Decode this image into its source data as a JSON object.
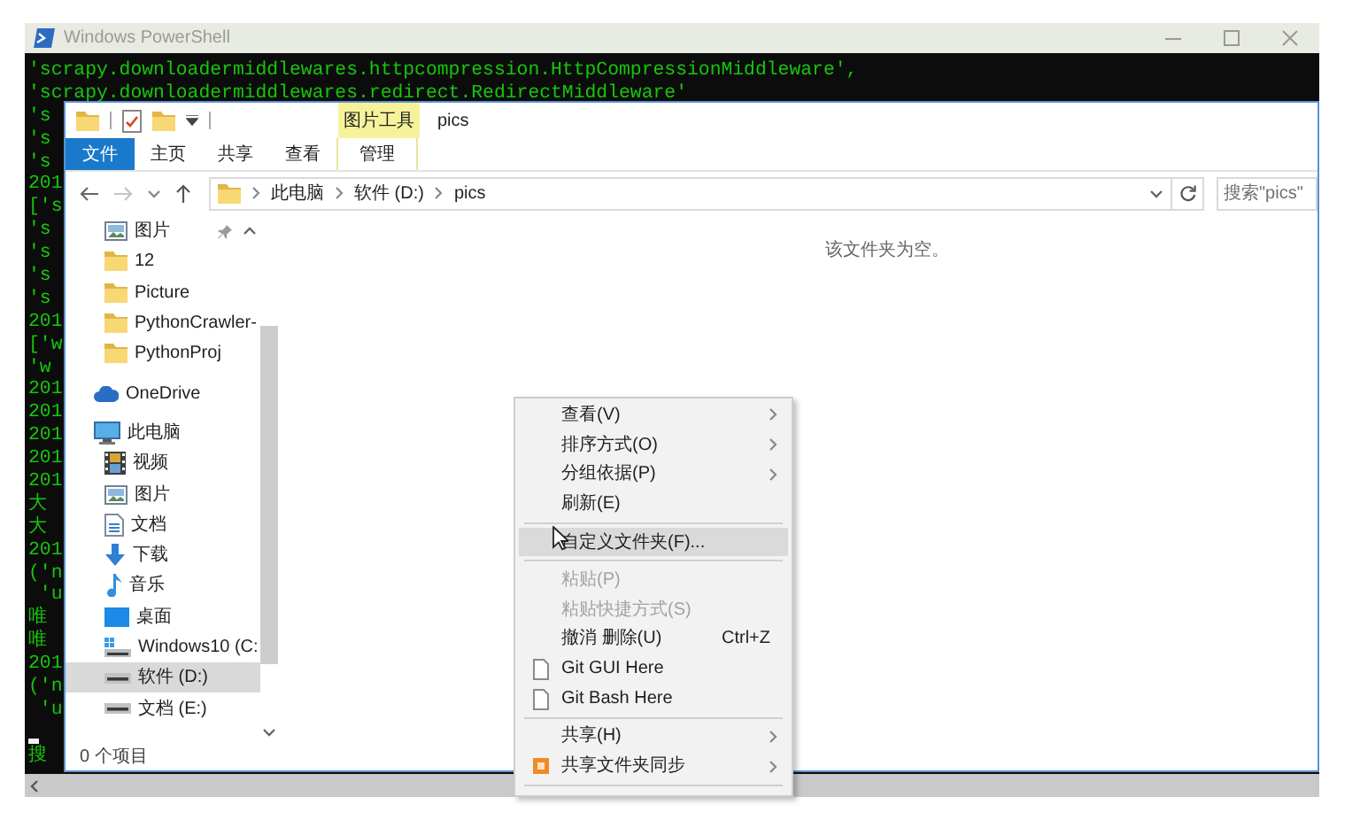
{
  "console": {
    "title": "Windows PowerShell",
    "lines": [
      {
        "kind": "output",
        "text": "'scrapy.downloadermiddlewares.httpcompression.HttpCompressionMiddleware',"
      },
      {
        "kind": "output",
        "text": "'scrapy.downloadermiddlewares.redirect.RedirectMiddleware'"
      },
      {
        "kind": "output",
        "text": "'s"
      },
      {
        "kind": "output",
        "text": "'s"
      },
      {
        "kind": "output",
        "text": "'s"
      },
      {
        "kind": "output",
        "text": "201"
      },
      {
        "kind": "output",
        "text": "['s"
      },
      {
        "kind": "output",
        "text": "'s"
      },
      {
        "kind": "output",
        "text": "'s"
      },
      {
        "kind": "output",
        "text": "'s"
      },
      {
        "kind": "output",
        "text": "'s"
      },
      {
        "kind": "output",
        "text": "201"
      },
      {
        "kind": "output",
        "text": "['w"
      },
      {
        "kind": "output",
        "text": "'w"
      },
      {
        "kind": "output",
        "text": "201"
      },
      {
        "kind": "output",
        "text": "201"
      },
      {
        "kind": "output",
        "text": "201"
      },
      {
        "kind": "output",
        "text": "201"
      },
      {
        "kind": "output",
        "text": "201"
      },
      {
        "kind": "output",
        "text": "大"
      },
      {
        "kind": "output",
        "text": "大"
      },
      {
        "kind": "output",
        "text": "201"
      },
      {
        "kind": "output",
        "text": "('n"
      },
      {
        "kind": "output",
        "text": " 'u"
      },
      {
        "kind": "output",
        "text": "唯"
      },
      {
        "kind": "output",
        "text": "唯"
      },
      {
        "kind": "output",
        "text": "201"
      },
      {
        "kind": "output",
        "text": "('n"
      },
      {
        "kind": "output",
        "text": " 'u"
      },
      {
        "kind": "cursor"
      },
      {
        "kind": "output",
        "text": "搜"
      }
    ]
  },
  "explorer": {
    "context_tab": "图片工具",
    "title": "pics",
    "ribbon_tabs": [
      {
        "label": "文件",
        "kind": "file"
      },
      {
        "label": "主页",
        "kind": "normal"
      },
      {
        "label": "共享",
        "kind": "normal"
      },
      {
        "label": "查看",
        "kind": "normal"
      },
      {
        "label": "管理",
        "kind": "context"
      }
    ],
    "breadcrumb": [
      "此电脑",
      "软件 (D:)",
      "pics"
    ],
    "search": {
      "placeholder": "搜索\"pics\""
    },
    "nav": {
      "quick_access": {
        "expanded": true,
        "items": [
          {
            "label": "图片",
            "kind": "pictures",
            "pinned": true,
            "selected": false
          },
          {
            "label": "12",
            "kind": "folder",
            "pinned": false,
            "selected": false
          },
          {
            "label": "Picture",
            "kind": "folder",
            "pinned": false,
            "selected": false
          },
          {
            "label": "PythonCrawler-",
            "kind": "folder",
            "pinned": false,
            "selected": false
          },
          {
            "label": "PythonProj",
            "kind": "folder",
            "pinned": false,
            "selected": false
          }
        ]
      },
      "roots": [
        {
          "label": "OneDrive",
          "kind": "cloud",
          "selected": false
        },
        {
          "label": "此电脑",
          "kind": "computer",
          "selected": false,
          "children": [
            {
              "label": "视频",
              "kind": "videos",
              "selected": false
            },
            {
              "label": "图片",
              "kind": "pictures",
              "selected": false
            },
            {
              "label": "文档",
              "kind": "documents",
              "selected": false
            },
            {
              "label": "下载",
              "kind": "downloads",
              "selected": false
            },
            {
              "label": "音乐",
              "kind": "music",
              "selected": false
            },
            {
              "label": "桌面",
              "kind": "desktop",
              "selected": false
            },
            {
              "label": "Windows10 (C:",
              "kind": "system-drive",
              "selected": false
            },
            {
              "label": "软件 (D:)",
              "kind": "drive",
              "selected": true
            },
            {
              "label": "文档 (E:)",
              "kind": "drive",
              "selected": false
            }
          ]
        }
      ]
    },
    "empty_message": "该文件夹为空。",
    "status": "0 个项目"
  },
  "context_menu": {
    "items": [
      {
        "kind": "plain",
        "label": "查看(V)",
        "submenu": true,
        "disabled": false,
        "highlighted": false
      },
      {
        "kind": "plain",
        "label": "排序方式(O)",
        "submenu": true,
        "disabled": false,
        "highlighted": false
      },
      {
        "kind": "plain",
        "label": "分组依据(P)",
        "submenu": true,
        "disabled": false,
        "highlighted": false
      },
      {
        "kind": "plain",
        "label": "刷新(E)",
        "submenu": false,
        "disabled": false,
        "highlighted": false
      },
      {
        "kind": "separator"
      },
      {
        "kind": "plain",
        "label": "自定义文件夹(F)...",
        "submenu": false,
        "disabled": false,
        "highlighted": true
      },
      {
        "kind": "separator"
      },
      {
        "kind": "plain",
        "label": "粘贴(P)",
        "submenu": false,
        "disabled": true,
        "highlighted": false
      },
      {
        "kind": "plain",
        "label": "粘贴快捷方式(S)",
        "submenu": false,
        "disabled": true,
        "highlighted": false
      },
      {
        "kind": "plain",
        "label": "撤消 删除(U)",
        "shortcut": "Ctrl+Z",
        "submenu": false,
        "disabled": false,
        "highlighted": false
      },
      {
        "kind": "page-icon",
        "label": "Git GUI Here",
        "submenu": false,
        "disabled": false,
        "highlighted": false
      },
      {
        "kind": "page-icon",
        "label": "Git Bash Here",
        "submenu": false,
        "disabled": false,
        "highlighted": false
      },
      {
        "kind": "separator"
      },
      {
        "kind": "plain",
        "label": "共享(H)",
        "submenu": true,
        "disabled": false,
        "highlighted": false
      },
      {
        "kind": "app-icon",
        "label": "共享文件夹同步",
        "submenu": true,
        "disabled": false,
        "highlighted": false
      },
      {
        "kind": "separator"
      }
    ]
  }
}
